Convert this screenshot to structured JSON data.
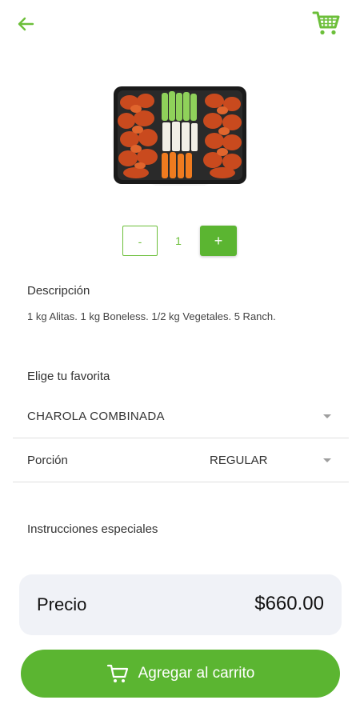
{
  "colors": {
    "accent": "#5bb531",
    "card_bg": "#f0f2f7"
  },
  "header": {
    "back_icon": "arrow-left-icon",
    "cart_icon": "shopping-cart-icon"
  },
  "product": {
    "image": "wings-boneless-vegetables-tray"
  },
  "quantity": {
    "minus_label": "-",
    "value": "1",
    "plus_label": "+"
  },
  "description": {
    "title": "Descripción",
    "text": "1 kg Alitas. 1 kg Boneless. 1/2 kg Vegetales. 5 Ranch."
  },
  "favorite": {
    "title": "Elige tu favorita",
    "selected": "CHAROLA COMBINADA"
  },
  "portion": {
    "label": "Porción",
    "selected": "REGULAR"
  },
  "instructions": {
    "title": "Instrucciones especiales"
  },
  "price": {
    "label": "Precio",
    "value": "$660.00"
  },
  "add_to_cart": {
    "icon": "cart-icon",
    "label": "Agregar al carrito"
  }
}
